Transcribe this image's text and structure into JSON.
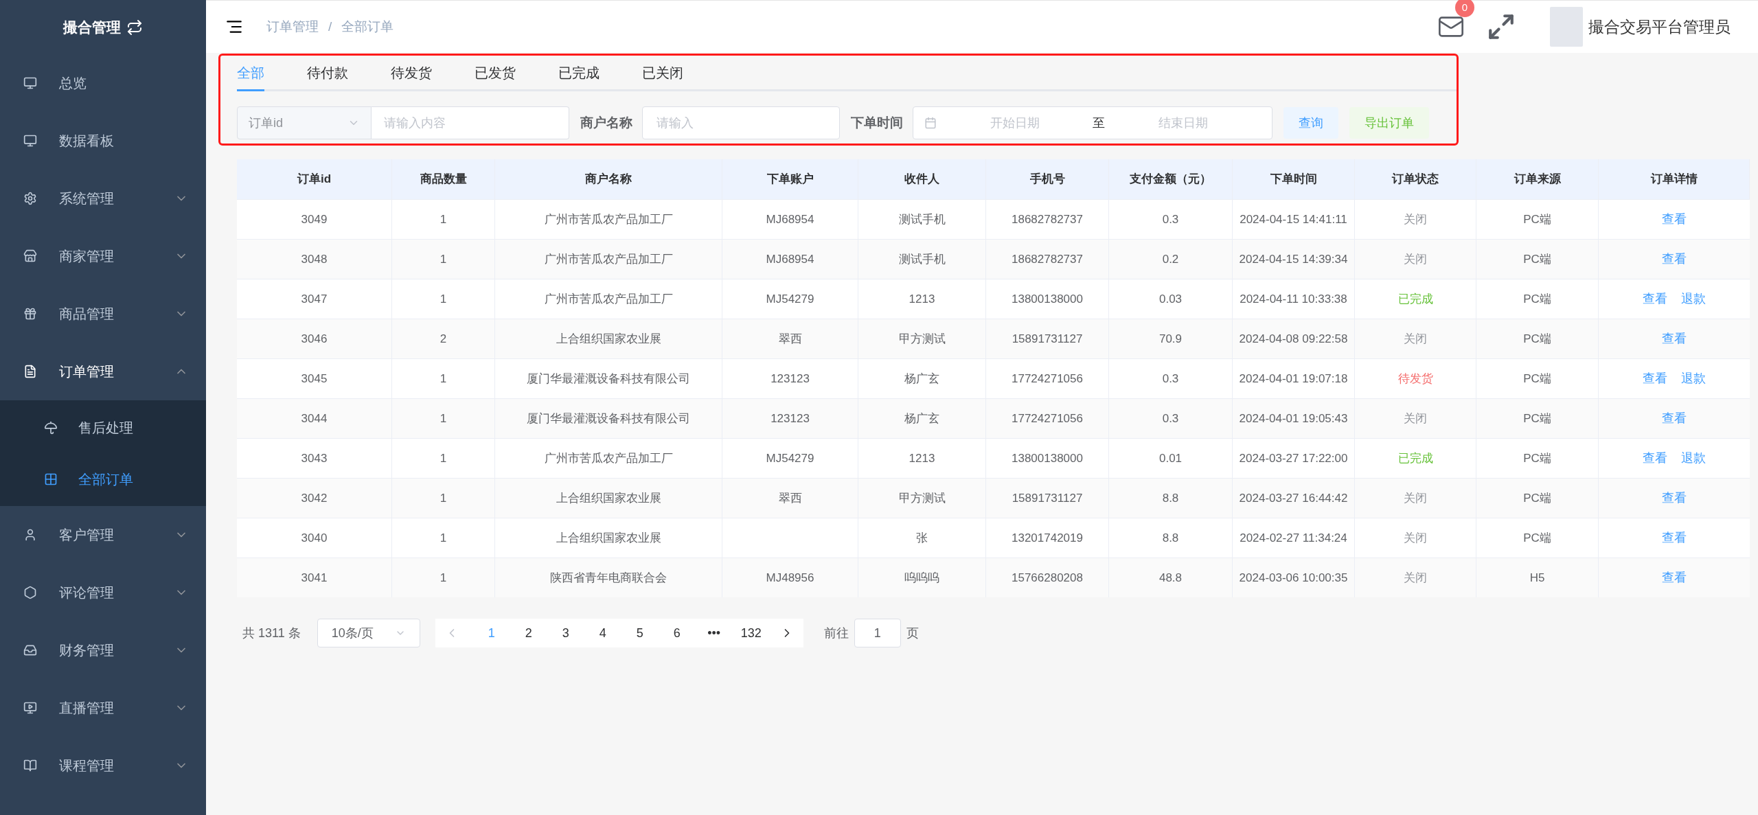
{
  "sidebar": {
    "brand": "撮合管理",
    "items": [
      {
        "label": "总览"
      },
      {
        "label": "数据看板"
      },
      {
        "label": "系统管理",
        "expanded": false
      },
      {
        "label": "商家管理",
        "expanded": false
      },
      {
        "label": "商品管理",
        "expanded": false
      },
      {
        "label": "订单管理",
        "expanded": true,
        "children": [
          {
            "label": "售后处理",
            "selected": false
          },
          {
            "label": "全部订单",
            "selected": true
          }
        ]
      },
      {
        "label": "客户管理",
        "expanded": false
      },
      {
        "label": "评论管理",
        "expanded": false
      },
      {
        "label": "财务管理",
        "expanded": false
      },
      {
        "label": "直播管理",
        "expanded": false
      },
      {
        "label": "课程管理",
        "expanded": false
      }
    ]
  },
  "header": {
    "breadcrumb": [
      "订单管理",
      "全部订单"
    ],
    "separator": "/",
    "mail_badge": "0",
    "user": "撮合交易平台管理员"
  },
  "tabs": [
    {
      "label": "全部",
      "selected": true
    },
    {
      "label": "待付款",
      "selected": false
    },
    {
      "label": "待发货",
      "selected": false
    },
    {
      "label": "已发货",
      "selected": false
    },
    {
      "label": "已完成",
      "selected": false
    },
    {
      "label": "已关闭",
      "selected": false
    }
  ],
  "filters": {
    "field_select": "订单id",
    "keyword_placeholder": "请输入内容",
    "merchant_label": "商户名称",
    "merchant_placeholder": "请输入",
    "time_label": "下单时间",
    "start_placeholder": "开始日期",
    "range_separator": "至",
    "end_placeholder": "结束日期",
    "search_button": "查询",
    "export_button": "导出订单"
  },
  "table": {
    "columns": [
      "订单id",
      "商品数量",
      "商户名称",
      "下单账户",
      "收件人",
      "手机号",
      "支付金额（元）",
      "下单时间",
      "订单状态",
      "订单来源",
      "订单详情"
    ],
    "rows": [
      {
        "cells": [
          "3049",
          "1",
          "广州市苦瓜农产品加工厂",
          "MJ68954",
          "测试手机",
          "18682782737",
          "0.3",
          "2024-04-15 14:41:11"
        ],
        "status": {
          "text": "关闭",
          "color": "#909399"
        },
        "source": "PC端",
        "actions": [
          "查看"
        ]
      },
      {
        "cells": [
          "3048",
          "1",
          "广州市苦瓜农产品加工厂",
          "MJ68954",
          "测试手机",
          "18682782737",
          "0.2",
          "2024-04-15 14:39:34"
        ],
        "status": {
          "text": "关闭",
          "color": "#909399"
        },
        "source": "PC端",
        "actions": [
          "查看"
        ]
      },
      {
        "cells": [
          "3047",
          "1",
          "广州市苦瓜农产品加工厂",
          "MJ54279",
          "1213",
          "13800138000",
          "0.03",
          "2024-04-11 10:33:38"
        ],
        "status": {
          "text": "已完成",
          "color": "#67c23a"
        },
        "source": "PC端",
        "actions": [
          "查看",
          "退款"
        ]
      },
      {
        "cells": [
          "3046",
          "2",
          "上合组织国家农业展",
          "翠西",
          "甲方测试",
          "15891731127",
          "70.9",
          "2024-04-08 09:22:58"
        ],
        "status": {
          "text": "关闭",
          "color": "#909399"
        },
        "source": "PC端",
        "actions": [
          "查看"
        ]
      },
      {
        "cells": [
          "3045",
          "1",
          "厦门华最灌溉设备科技有限公司",
          "123123",
          "杨广玄",
          "17724271056",
          "0.3",
          "2024-04-01 19:07:18"
        ],
        "status": {
          "text": "待发货",
          "color": "#f56c6c"
        },
        "source": "PC端",
        "actions": [
          "查看",
          "退款"
        ]
      },
      {
        "cells": [
          "3044",
          "1",
          "厦门华最灌溉设备科技有限公司",
          "123123",
          "杨广玄",
          "17724271056",
          "0.3",
          "2024-04-01 19:05:43"
        ],
        "status": {
          "text": "关闭",
          "color": "#909399"
        },
        "source": "PC端",
        "actions": [
          "查看"
        ]
      },
      {
        "cells": [
          "3043",
          "1",
          "广州市苦瓜农产品加工厂",
          "MJ54279",
          "1213",
          "13800138000",
          "0.01",
          "2024-03-27 17:22:00"
        ],
        "status": {
          "text": "已完成",
          "color": "#67c23a"
        },
        "source": "PC端",
        "actions": [
          "查看",
          "退款"
        ]
      },
      {
        "cells": [
          "3042",
          "1",
          "上合组织国家农业展",
          "翠西",
          "甲方测试",
          "15891731127",
          "8.8",
          "2024-03-27 16:44:42"
        ],
        "status": {
          "text": "关闭",
          "color": "#909399"
        },
        "source": "PC端",
        "actions": [
          "查看"
        ]
      },
      {
        "cells": [
          "3040",
          "1",
          "上合组织国家农业展",
          "",
          "张",
          "13201742019",
          "8.8",
          "2024-02-27 11:34:24"
        ],
        "status": {
          "text": "关闭",
          "color": "#909399"
        },
        "source": "PC端",
        "actions": [
          "查看"
        ]
      },
      {
        "cells": [
          "3041",
          "1",
          "陕西省青年电商联合会",
          "MJ48956",
          "呜呜呜",
          "15766280208",
          "48.8",
          "2024-03-06 10:00:35"
        ],
        "status": {
          "text": "关闭",
          "color": "#909399"
        },
        "source": "H5",
        "actions": [
          "查看"
        ]
      }
    ]
  },
  "pagination": {
    "total": "共 1311 条",
    "page_size": "10条/页",
    "pages": [
      {
        "label": "1",
        "selected": true
      },
      {
        "label": "2",
        "selected": false
      },
      {
        "label": "3",
        "selected": false
      },
      {
        "label": "4",
        "selected": false
      },
      {
        "label": "5",
        "selected": false
      },
      {
        "label": "6",
        "selected": false
      },
      {
        "label": "•••",
        "selected": false
      },
      {
        "label": "132",
        "selected": false
      }
    ],
    "goto_label": "前往",
    "goto_value": "1",
    "page_unit": "页"
  }
}
